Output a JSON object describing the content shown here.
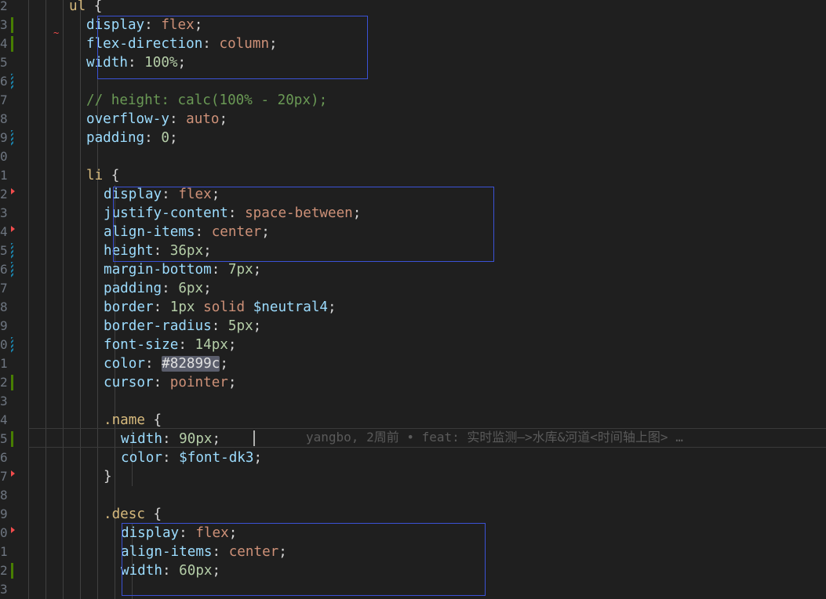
{
  "editor": {
    "line_numbers": [
      "2",
      "3",
      "4",
      "5",
      "6",
      "7",
      "8",
      "9",
      "0",
      "1",
      "2",
      "3",
      "4",
      "5",
      "6",
      "7",
      "8",
      "9",
      "0",
      "1",
      "2",
      "3",
      "4",
      "5",
      "6",
      "7",
      "8",
      "9",
      "0",
      "1",
      "2",
      "3"
    ],
    "lines": [
      [
        {
          "t": "ul",
          "c": "sel"
        },
        {
          "t": " {",
          "c": "punc"
        }
      ],
      [
        {
          "t": "display",
          "c": "prop"
        },
        {
          "t": ": ",
          "c": "punc"
        },
        {
          "t": "flex",
          "c": "val"
        },
        {
          "t": ";",
          "c": "punc"
        }
      ],
      [
        {
          "t": "flex-direction",
          "c": "prop"
        },
        {
          "t": ": ",
          "c": "punc"
        },
        {
          "t": "column",
          "c": "val"
        },
        {
          "t": ";",
          "c": "punc"
        }
      ],
      [
        {
          "t": "width",
          "c": "prop"
        },
        {
          "t": ": ",
          "c": "punc"
        },
        {
          "t": "100%",
          "c": "num"
        },
        {
          "t": ";",
          "c": "punc"
        }
      ],
      [],
      [
        {
          "t": "// height: calc(100% - 20px);",
          "c": "cmt"
        }
      ],
      [
        {
          "t": "overflow-y",
          "c": "prop"
        },
        {
          "t": ": ",
          "c": "punc"
        },
        {
          "t": "auto",
          "c": "val"
        },
        {
          "t": ";",
          "c": "punc"
        }
      ],
      [
        {
          "t": "padding",
          "c": "prop"
        },
        {
          "t": ": ",
          "c": "punc"
        },
        {
          "t": "0",
          "c": "num"
        },
        {
          "t": ";",
          "c": "punc"
        }
      ],
      [],
      [
        {
          "t": "li",
          "c": "sel"
        },
        {
          "t": " {",
          "c": "punc"
        }
      ],
      [
        {
          "t": "display",
          "c": "prop"
        },
        {
          "t": ": ",
          "c": "punc"
        },
        {
          "t": "flex",
          "c": "val"
        },
        {
          "t": ";",
          "c": "punc"
        }
      ],
      [
        {
          "t": "justify-content",
          "c": "prop"
        },
        {
          "t": ": ",
          "c": "punc"
        },
        {
          "t": "space-between",
          "c": "val"
        },
        {
          "t": ";",
          "c": "punc"
        }
      ],
      [
        {
          "t": "align-items",
          "c": "prop"
        },
        {
          "t": ": ",
          "c": "punc"
        },
        {
          "t": "center",
          "c": "val"
        },
        {
          "t": ";",
          "c": "punc"
        }
      ],
      [
        {
          "t": "height",
          "c": "prop"
        },
        {
          "t": ": ",
          "c": "punc"
        },
        {
          "t": "36px",
          "c": "num"
        },
        {
          "t": ";",
          "c": "punc"
        }
      ],
      [
        {
          "t": "margin-bottom",
          "c": "prop"
        },
        {
          "t": ": ",
          "c": "punc"
        },
        {
          "t": "7px",
          "c": "num"
        },
        {
          "t": ";",
          "c": "punc"
        }
      ],
      [
        {
          "t": "padding",
          "c": "prop"
        },
        {
          "t": ": ",
          "c": "punc"
        },
        {
          "t": "6px",
          "c": "num"
        },
        {
          "t": ";",
          "c": "punc"
        }
      ],
      [
        {
          "t": "border",
          "c": "prop"
        },
        {
          "t": ": ",
          "c": "punc"
        },
        {
          "t": "1px",
          "c": "num"
        },
        {
          "t": " ",
          "c": "punc"
        },
        {
          "t": "solid",
          "c": "val"
        },
        {
          "t": " ",
          "c": "punc"
        },
        {
          "t": "$neutral4",
          "c": "var"
        },
        {
          "t": ";",
          "c": "punc"
        }
      ],
      [
        {
          "t": "border-radius",
          "c": "prop"
        },
        {
          "t": ": ",
          "c": "punc"
        },
        {
          "t": "5px",
          "c": "num"
        },
        {
          "t": ";",
          "c": "punc"
        }
      ],
      [
        {
          "t": "font-size",
          "c": "prop"
        },
        {
          "t": ": ",
          "c": "punc"
        },
        {
          "t": "14px",
          "c": "num"
        },
        {
          "t": ";",
          "c": "punc"
        }
      ],
      [
        {
          "t": "color",
          "c": "prop"
        },
        {
          "t": ": ",
          "c": "punc"
        },
        {
          "t": "#82899c",
          "c": "hex"
        },
        {
          "t": ";",
          "c": "punc"
        }
      ],
      [
        {
          "t": "cursor",
          "c": "prop"
        },
        {
          "t": ": ",
          "c": "punc"
        },
        {
          "t": "pointer",
          "c": "val"
        },
        {
          "t": ";",
          "c": "punc"
        }
      ],
      [],
      [
        {
          "t": ".name",
          "c": "sel"
        },
        {
          "t": " {",
          "c": "punc"
        }
      ],
      [
        {
          "t": "width",
          "c": "prop"
        },
        {
          "t": ": ",
          "c": "punc"
        },
        {
          "t": "90px",
          "c": "num"
        },
        {
          "t": ";",
          "c": "punc"
        }
      ],
      [
        {
          "t": "color",
          "c": "prop"
        },
        {
          "t": ": ",
          "c": "punc"
        },
        {
          "t": "$font-dk3",
          "c": "var"
        },
        {
          "t": ";",
          "c": "punc"
        }
      ],
      [
        {
          "t": "}",
          "c": "punc"
        }
      ],
      [],
      [
        {
          "t": ".desc",
          "c": "sel"
        },
        {
          "t": " {",
          "c": "punc"
        }
      ],
      [
        {
          "t": "display",
          "c": "prop"
        },
        {
          "t": ": ",
          "c": "punc"
        },
        {
          "t": "flex",
          "c": "val"
        },
        {
          "t": ";",
          "c": "punc"
        }
      ],
      [
        {
          "t": "align-items",
          "c": "prop"
        },
        {
          "t": ": ",
          "c": "punc"
        },
        {
          "t": "center",
          "c": "val"
        },
        {
          "t": ";",
          "c": "punc"
        }
      ],
      [
        {
          "t": "width",
          "c": "prop"
        },
        {
          "t": ": ",
          "c": "punc"
        },
        {
          "t": "60px",
          "c": "num"
        },
        {
          "t": ";",
          "c": "punc"
        }
      ],
      []
    ],
    "git_blame": "yangbo, 2周前 • feat: 实时监测—>水库&河道<时间轴上图> …"
  },
  "colors": {
    "background": "#1f1f1f",
    "selector": "#d7ba7d",
    "property": "#9cdcfe",
    "value": "#ce9178",
    "number": "#b5cea8",
    "comment": "#6a9955",
    "highlight_box": "#3b52d6",
    "git_added": "#487e02",
    "git_modified": "#1b81a8",
    "git_deleted": "#f14c4c"
  }
}
